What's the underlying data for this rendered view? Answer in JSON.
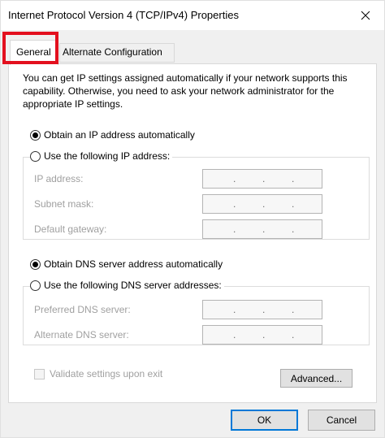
{
  "window": {
    "title": "Internet Protocol Version 4 (TCP/IPv4) Properties",
    "close_icon": "close-icon"
  },
  "tabs": [
    {
      "label": "General",
      "selected": true
    },
    {
      "label": "Alternate Configuration",
      "selected": false
    }
  ],
  "highlight_color": "#e3101e",
  "general": {
    "intro": "You can get IP settings assigned automatically if your network supports this capability. Otherwise, you need to ask your network administrator for the appropriate IP settings.",
    "ip": {
      "auto_label": "Obtain an IP address automatically",
      "auto_selected": true,
      "manual_label": "Use the following IP address:",
      "manual_selected": false,
      "fields": [
        {
          "label": "IP address:",
          "value": ""
        },
        {
          "label": "Subnet mask:",
          "value": ""
        },
        {
          "label": "Default gateway:",
          "value": ""
        }
      ]
    },
    "dns": {
      "auto_label": "Obtain DNS server address automatically",
      "auto_selected": true,
      "manual_label": "Use the following DNS server addresses:",
      "manual_selected": false,
      "fields": [
        {
          "label": "Preferred DNS server:",
          "value": ""
        },
        {
          "label": "Alternate DNS server:",
          "value": ""
        }
      ]
    },
    "validate_label": "Validate settings upon exit",
    "validate_checked": false,
    "advanced_label": "Advanced..."
  },
  "buttons": {
    "ok": "OK",
    "cancel": "Cancel"
  },
  "colors": {
    "accent": "#0078d7",
    "disabled_text": "#a0a0a0"
  }
}
